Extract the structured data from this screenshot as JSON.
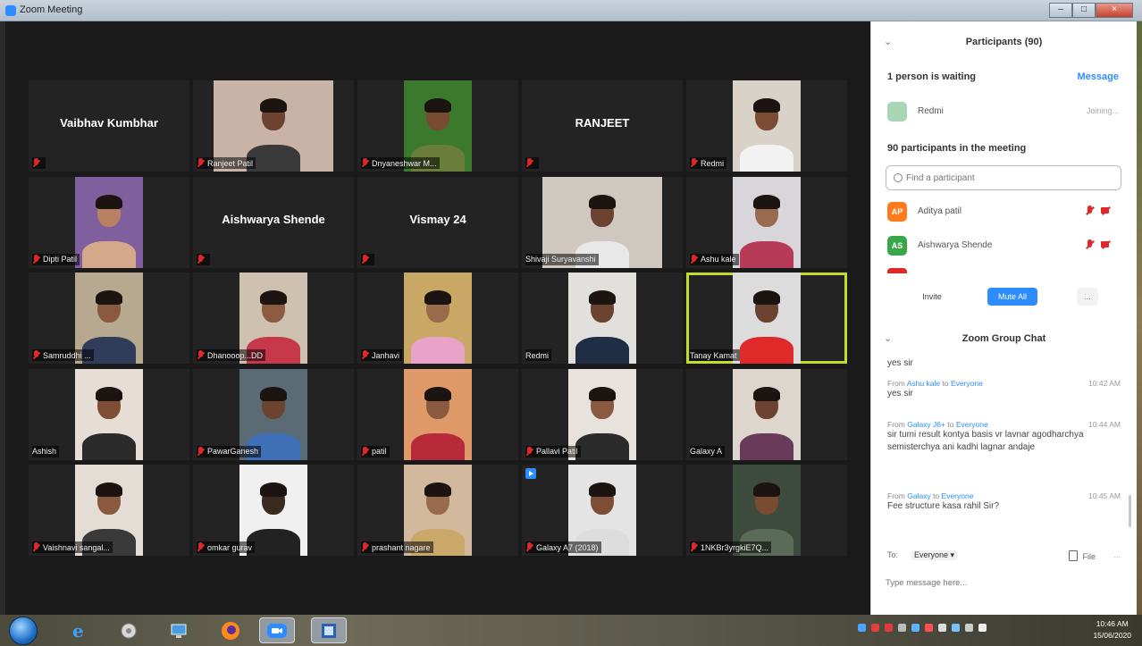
{
  "window": {
    "title": "Zoom Meeting"
  },
  "tiles": [
    {
      "name": "Vaibhav Kumbhar",
      "label": "",
      "muted": true,
      "video": false
    },
    {
      "name": "",
      "label": "Ranjeet Patil",
      "muted": true,
      "video": true,
      "width": "wide",
      "bg": "#c8b3a6",
      "skin": "#6b4330",
      "shirt": "#3a3a3a"
    },
    {
      "name": "",
      "label": "Dnyaneshwar M...",
      "muted": true,
      "video": true,
      "bg": "#3b7a2c",
      "skin": "#7a4b33",
      "shirt": "#6b7d3a"
    },
    {
      "name": "RANJEET",
      "label": "",
      "muted": true,
      "video": false
    },
    {
      "name": "",
      "label": "Redmi",
      "muted": true,
      "video": true,
      "bg": "#d9d2c8",
      "skin": "#7b4c33",
      "shirt": "#f2f2f2"
    },
    {
      "name": "",
      "label": "Dipti Patil",
      "muted": true,
      "video": true,
      "bg": "#7f5f9d",
      "skin": "#b98064",
      "shirt": "#d6a88b"
    },
    {
      "name": "Aishwarya Shende",
      "label": "",
      "muted": true,
      "video": false
    },
    {
      "name": "Vismay 24",
      "label": "",
      "muted": true,
      "video": false
    },
    {
      "name": "",
      "label": "Shivaji Suryavanshi",
      "muted": false,
      "video": true,
      "width": "wide",
      "bg": "#cfc8c0",
      "skin": "#6b4330",
      "shirt": "#e8e8e8"
    },
    {
      "name": "",
      "label": "Ashu kale",
      "muted": true,
      "video": true,
      "bg": "#d8d6da",
      "skin": "#9a6a50",
      "shirt": "#b63b58"
    },
    {
      "name": "",
      "label": "Samruddhi ...",
      "muted": true,
      "video": true,
      "bg": "#b7a98f",
      "skin": "#8a5a40",
      "shirt": "#2f3d5a"
    },
    {
      "name": "",
      "label": "Dhanooop...DD",
      "muted": true,
      "video": true,
      "bg": "#cfc1b0",
      "skin": "#8c5b42",
      "shirt": "#c7384a"
    },
    {
      "name": "",
      "label": "Janhavi",
      "muted": true,
      "video": true,
      "bg": "#c9a865",
      "skin": "#9a6a4c",
      "shirt": "#e9a3c8"
    },
    {
      "name": "",
      "label": "Redmi",
      "muted": false,
      "video": true,
      "bg": "#e2e0dc",
      "skin": "#6b4330",
      "shirt": "#1f2d45"
    },
    {
      "name": "",
      "label": "Tanay Kamat",
      "muted": false,
      "video": true,
      "active": true,
      "bg": "#dcdcdc",
      "skin": "#6b4330",
      "shirt": "#e02a2a"
    },
    {
      "name": "",
      "label": "Ashish",
      "muted": false,
      "video": true,
      "bg": "#e6ddd6",
      "skin": "#7d4d36",
      "shirt": "#2b2b2b"
    },
    {
      "name": "",
      "label": "PawarGanesh",
      "muted": true,
      "video": true,
      "bg": "#5b6b76",
      "skin": "#6b4330",
      "shirt": "#3f6fb6"
    },
    {
      "name": "",
      "label": "patil",
      "muted": true,
      "video": true,
      "bg": "#e09a6a",
      "skin": "#8a5a40",
      "shirt": "#b72a3a"
    },
    {
      "name": "",
      "label": "Pallavi Patil",
      "muted": true,
      "video": true,
      "bg": "#e8e2dc",
      "skin": "#8a5a40",
      "shirt": "#2b2b2b"
    },
    {
      "name": "",
      "label": "Galaxy A",
      "muted": false,
      "video": true,
      "bg": "#ddd6ce",
      "skin": "#6b4330",
      "shirt": "#6a3a5a"
    },
    {
      "name": "",
      "label": "Vaishnavi sangal...",
      "muted": true,
      "video": true,
      "bg": "#e4ddd5",
      "skin": "#8a5a40",
      "shirt": "#3a3a3a"
    },
    {
      "name": "",
      "label": "omkar gurav",
      "muted": true,
      "video": true,
      "bg": "#f0f0f0",
      "skin": "#3b2a20",
      "shirt": "#222"
    },
    {
      "name": "",
      "label": "prashant nagare",
      "muted": true,
      "video": true,
      "bg": "#d2b89c",
      "skin": "#9a6a4c",
      "shirt": "#c9a86a"
    },
    {
      "name": "",
      "label": "Galaxy A7 (2018)",
      "muted": true,
      "video": true,
      "badge": true,
      "bg": "#e4e4e4",
      "skin": "#7d4d36",
      "shirt": "#ddd"
    },
    {
      "name": "",
      "label": "1NKBr3yrgkiE7Q...",
      "muted": true,
      "video": true,
      "bg": "#3d4a3e",
      "skin": "#7a4b33",
      "shirt": "#5b6b5a"
    }
  ],
  "panel": {
    "participants_title": "Participants (90)",
    "waiting_text": "1 person is waiting",
    "message_label": "Message",
    "waiting_person": {
      "initials": "",
      "name": "Redmi",
      "status": "Joining...",
      "color": "#a9d7b6"
    },
    "count_text": "90 participants in the meeting",
    "search_placeholder": "Find a participant",
    "participants": [
      {
        "initials": "AP",
        "name": "Aditya patil",
        "color": "#ff7a1a"
      },
      {
        "initials": "AS",
        "name": "Aishwarya Shende",
        "color": "#3aa64a"
      }
    ],
    "invite_label": "Invite",
    "mute_all_label": "Mute All",
    "more_label": "...",
    "chat_title": "Zoom Group Chat",
    "chat_prev": "yes sir",
    "messages": [
      {
        "from_prefix": "From",
        "sender": "Ashu kale",
        "to_word": "to",
        "recipient": "Everyone",
        "time": "10:42 AM",
        "text": "yes sir"
      },
      {
        "from_prefix": "From",
        "sender": "Galaxy J6+",
        "to_word": "to",
        "recipient": "Everyone",
        "time": "10:44 AM",
        "text": "sir tumi result kontya basis vr lavnar agodharchya semisterchya ani kadhi lagnar andaje"
      },
      {
        "from_prefix": "From",
        "sender": "Galaxy",
        "to_word": "to",
        "recipient": "Everyone",
        "time": "10:45 AM",
        "text": "Fee structure kasa rahil Sir?"
      }
    ],
    "to_label": "To:",
    "to_value": "Everyone ▾",
    "file_label": "File",
    "dots_label": "...",
    "type_placeholder": "Type message here..."
  },
  "taskbar": {
    "time": "10:46 AM",
    "date": "15/06/2020"
  }
}
